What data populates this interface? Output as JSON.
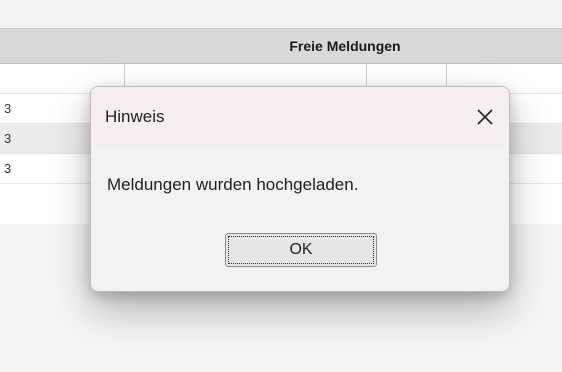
{
  "background": {
    "header_title": "Freie Meldungen",
    "row_markers": [
      "3",
      "3",
      "3"
    ]
  },
  "dialog": {
    "title": "Hinweis",
    "message": "Meldungen wurden hochgeladen.",
    "ok_label": "OK",
    "close_icon": "close-icon"
  },
  "colors": {
    "dialog_titlebar": "#f5edef",
    "dialog_body": "#f2f2f2",
    "header_bar": "#d9d9d9"
  }
}
